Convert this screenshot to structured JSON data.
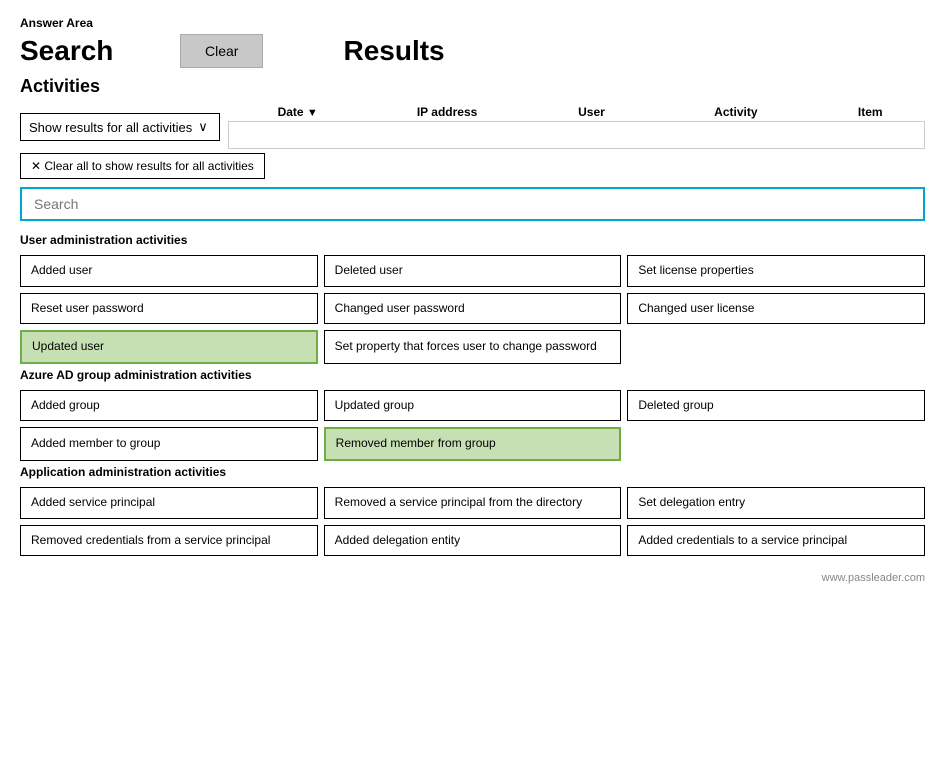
{
  "page": {
    "answer_area_label": "Answer Area",
    "search_heading": "Search",
    "clear_button_label": "Clear",
    "results_heading": "Results",
    "activities_section_label": "Activities",
    "filter_dropdown_label": "Show results for all activities",
    "filter_dropdown_chevron": "∨",
    "clear_filter_label": "✕ Clear all to show results for all activities",
    "search_placeholder": "Search",
    "col_date": "Date",
    "col_date_arrow": "▼",
    "col_ip": "IP address",
    "col_user": "User",
    "col_activity": "Activity",
    "col_item": "Item",
    "user_admin_section": "User administration activities",
    "azure_ad_section": "Azure AD group administration activities",
    "app_admin_section": "Application administration activities",
    "user_activities": [
      {
        "label": "Added user",
        "selected": false,
        "col": 0
      },
      {
        "label": "Deleted user",
        "selected": false,
        "col": 1
      },
      {
        "label": "Set license properties",
        "selected": false,
        "col": 2
      },
      {
        "label": "Reset user password",
        "selected": false,
        "col": 0
      },
      {
        "label": "Changed user password",
        "selected": false,
        "col": 1
      },
      {
        "label": "Changed user license",
        "selected": false,
        "col": 2
      },
      {
        "label": "Updated user",
        "selected": true,
        "col": 0
      },
      {
        "label": "Set property that forces user to change password",
        "selected": false,
        "col": 1
      },
      {
        "label": "",
        "selected": false,
        "col": 2,
        "empty": true
      }
    ],
    "azure_activities": [
      {
        "label": "Added group",
        "selected": false,
        "col": 0
      },
      {
        "label": "Updated group",
        "selected": false,
        "col": 1
      },
      {
        "label": "Deleted group",
        "selected": false,
        "col": 2
      },
      {
        "label": "Added member to group",
        "selected": false,
        "col": 0
      },
      {
        "label": "Removed member from group",
        "selected": true,
        "col": 1
      },
      {
        "label": "",
        "selected": false,
        "col": 2,
        "empty": true
      }
    ],
    "app_activities": [
      {
        "label": "Added service principal",
        "selected": false,
        "col": 0
      },
      {
        "label": "Removed a service principal from the directory",
        "selected": false,
        "col": 1
      },
      {
        "label": "Set delegation entry",
        "selected": false,
        "col": 2
      },
      {
        "label": "Removed credentials from a service principal",
        "selected": false,
        "col": 0
      },
      {
        "label": "Added delegation entity",
        "selected": false,
        "col": 1
      },
      {
        "label": "Added credentials to a service principal",
        "selected": false,
        "col": 2
      }
    ],
    "watermark": "www.passleader.com"
  }
}
